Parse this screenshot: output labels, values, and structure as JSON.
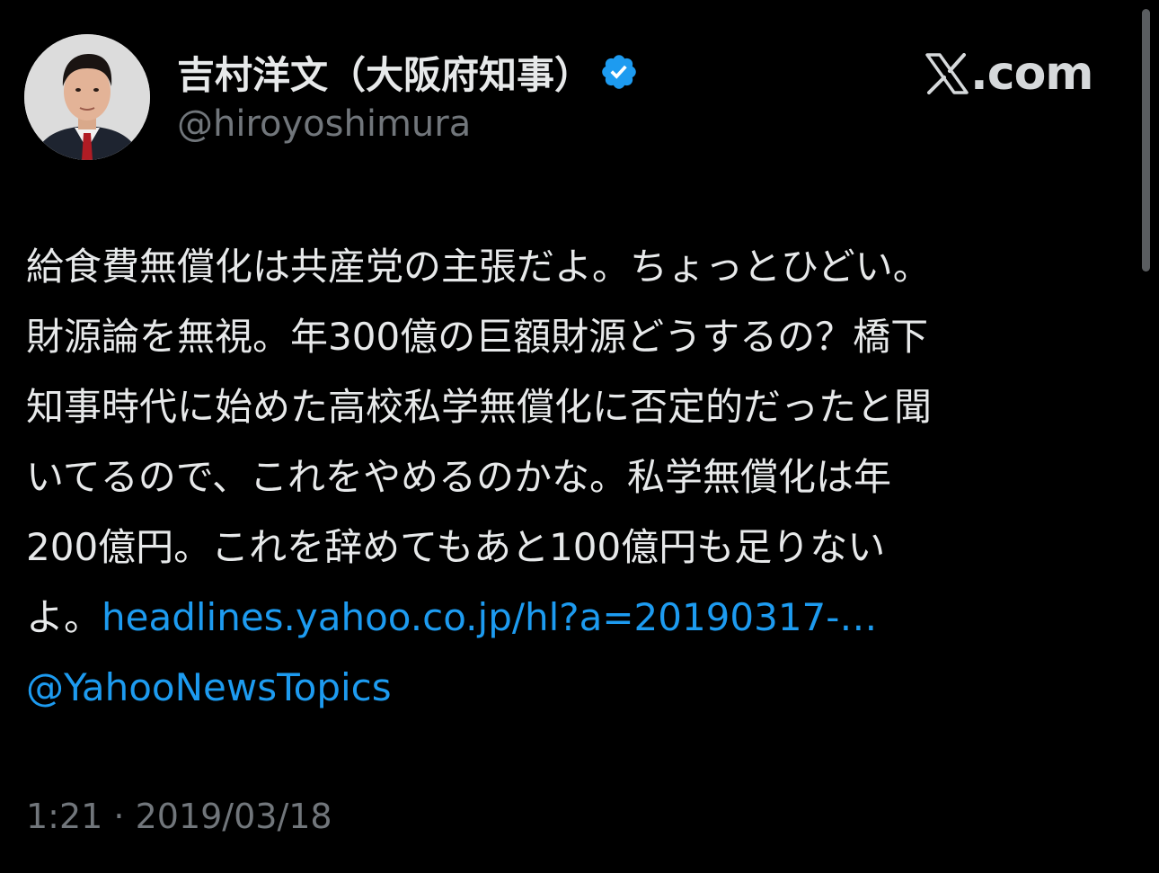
{
  "author": {
    "display_name": "吉村洋文（大阪府知事）",
    "handle": "@hiroyoshimura",
    "verified": true,
    "avatar_icon": "profile-photo-icon"
  },
  "brand": {
    "logo_icon": "x-logo-icon",
    "domain": ".com"
  },
  "tweet": {
    "lines": [
      "給食費無償化は共産党の主張だよ。ちょっとひどい。",
      "財源論を無視。年300億の巨額財源どうするの？橋下",
      "知事時代に始めた高校私学無償化に否定的だったと聞",
      "いてるので、これをやめるのかな。私学無償化は年",
      "200億円。これを辞めてもあと100億円も足りない"
    ],
    "last_line_prefix": "よ。",
    "link": "headlines.yahoo.co.jp/hl?a=20190317-…",
    "mention": "@YahooNewsTopics"
  },
  "meta": {
    "time": "1:21",
    "separator": " · ",
    "date": "2019/03/18"
  },
  "colors": {
    "background": "#000000",
    "text": "#e7e9ea",
    "secondary": "#71767b",
    "link": "#1d9bf0",
    "verified": "#1d9bf0"
  }
}
